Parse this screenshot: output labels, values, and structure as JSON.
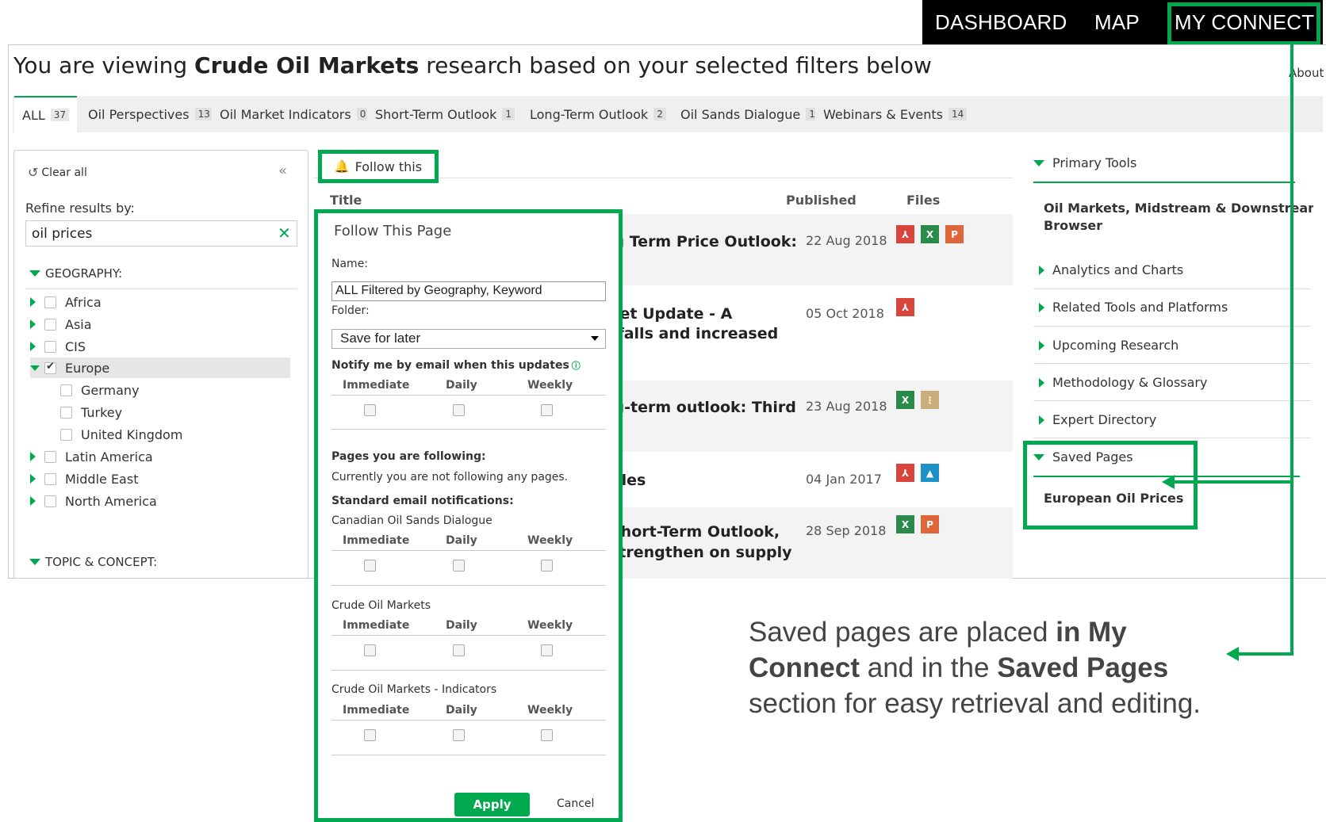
{
  "topnav": {
    "items": [
      "DASHBOARD",
      "MAP",
      "MY CONNECT"
    ]
  },
  "heading": {
    "prefix": "You are viewing ",
    "topic": "Crude Oil Markets",
    "suffix": " research based on your selected filters below",
    "about": "About"
  },
  "tabs": [
    {
      "label": "ALL",
      "count": "37"
    },
    {
      "label": "Oil Perspectives",
      "count": "13"
    },
    {
      "label": "Oil Market Indicators",
      "count": "0"
    },
    {
      "label": "Short-Term Outlook",
      "count": "1"
    },
    {
      "label": "Long-Term Outlook",
      "count": "2"
    },
    {
      "label": "Oil Sands Dialogue",
      "count": "1"
    },
    {
      "label": "Webinars & Events",
      "count": "14"
    }
  ],
  "filters": {
    "clear_all": "Clear all",
    "refine_label": "Refine results by:",
    "search_value": "oil prices",
    "geography_header": "GEOGRAPHY:",
    "topic_header": "TOPIC & CONCEPT:",
    "geography": [
      {
        "label": "Africa",
        "checked": false
      },
      {
        "label": "Asia",
        "checked": false
      },
      {
        "label": "CIS",
        "checked": false
      },
      {
        "label": "Europe",
        "checked": true
      },
      {
        "label": "Germany",
        "checked": false
      },
      {
        "label": "Turkey",
        "checked": false
      },
      {
        "label": "United Kingdom",
        "checked": false
      },
      {
        "label": "Latin America",
        "checked": false
      },
      {
        "label": "Middle East",
        "checked": false
      },
      {
        "label": "North America",
        "checked": false
      }
    ]
  },
  "results": {
    "follow_label": "Follow this",
    "columns": {
      "title": "Title",
      "published": "Published",
      "files": "Files"
    },
    "rows": [
      {
        "title_lines": [
          "ng Term Price Outlook:"
        ],
        "date": "22 Aug 2018",
        "files": [
          "pdf",
          "xls",
          "ppt"
        ]
      },
      {
        "title_lines": [
          "rket Update - A",
          "rtfalls and increased"
        ],
        "date": "05 Oct 2018",
        "files": [
          "pdf"
        ]
      },
      {
        "title_lines": [
          "ng-term outlook: Third"
        ],
        "date": "23 Aug 2018",
        "files": [
          "xls",
          "zip"
        ]
      },
      {
        "title_lines": [
          "ycles"
        ],
        "date": "04 Jan 2017",
        "files": [
          "pdf",
          "img"
        ]
      },
      {
        "title_lines": [
          "Short-Term Outlook,",
          "strengthen on supply"
        ],
        "date": "28 Sep 2018",
        "files": [
          "xls",
          "ppt"
        ]
      }
    ]
  },
  "popup": {
    "title": "Follow This Page",
    "name_label": "Name:",
    "name_value": "ALL Filtered by Geography, Keyword",
    "folder_label": "Folder:",
    "folder_value": "Save for later",
    "notify_label": "Notify me by email when this updates",
    "freq": [
      "Immediate",
      "Daily",
      "Weekly"
    ],
    "following_label": "Pages you are following:",
    "following_text": "Currently you are not following any pages.",
    "standard_label": "Standard email notifications:",
    "subscriptions": [
      "Canadian Oil Sands Dialogue",
      "Crude Oil Markets",
      "Crude Oil Markets - Indicators"
    ],
    "apply": "Apply",
    "cancel": "Cancel"
  },
  "sidebar": {
    "primary_tools": "Primary Tools",
    "browser_link": [
      "Oil Markets, Midstream & Downstream Data",
      "Browser"
    ],
    "sections": [
      "Analytics and Charts",
      "Related Tools and Platforms",
      "Upcoming Research",
      "Methodology & Glossary",
      "Expert Directory"
    ],
    "saved_pages": "Saved Pages",
    "saved_item": "European Oil Prices"
  },
  "caption": {
    "t1": "Saved pages are placed ",
    "b1": "in My Connect",
    "t2": " and in the ",
    "b2": "Saved Pages",
    "t3": " section for easy retrieval and editing."
  },
  "colors": {
    "accent": "#00a850",
    "nav_bg": "#000000",
    "pdf": "#d9453b",
    "xls": "#2a8a4a",
    "ppt": "#e0663a"
  }
}
